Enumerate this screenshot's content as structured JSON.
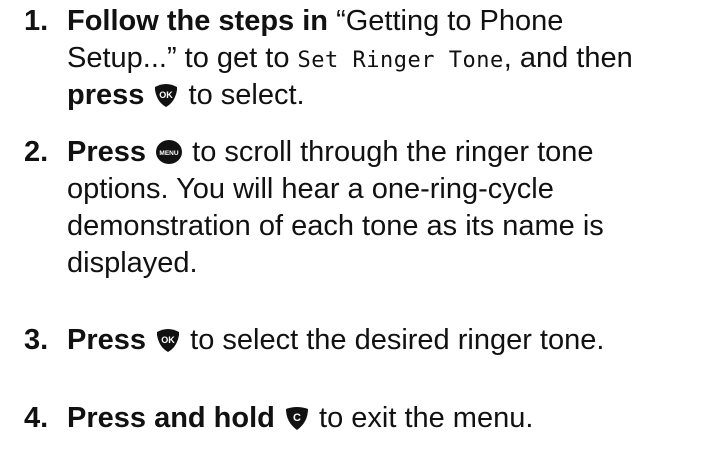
{
  "steps": [
    {
      "number": "1.",
      "lines": [
        {
          "bold1": "Follow the steps in",
          "text1": " “Getting to Phone"
        },
        {
          "text1": "Setup...” to get to ",
          "lcd": "Set Ringer Tone",
          "text2": ", and then"
        },
        {
          "bold1": "press",
          "icon": "ok-key-icon",
          "text1": " to select."
        }
      ]
    },
    {
      "number": "2.",
      "lines": [
        {
          "bold1": "Press",
          "icon": "menu-key-icon",
          "text1": " to scroll through the ringer tone"
        },
        {
          "text1": "options. You will hear a one-ring-cycle"
        },
        {
          "text1": "demonstration of each tone as its name is"
        },
        {
          "text1": "displayed."
        }
      ]
    },
    {
      "number": "3.",
      "lines": [
        {
          "bold1": "Press",
          "icon": "ok-key-icon",
          "text1": " to select the desired ringer tone."
        }
      ]
    },
    {
      "number": "4.",
      "lines": [
        {
          "bold1": "Press and hold",
          "icon": "clear-key-icon",
          "text1": " to exit the menu."
        }
      ]
    }
  ],
  "icons": {
    "ok_label": "OK",
    "menu_label": "MENU",
    "clear_label": "C"
  }
}
